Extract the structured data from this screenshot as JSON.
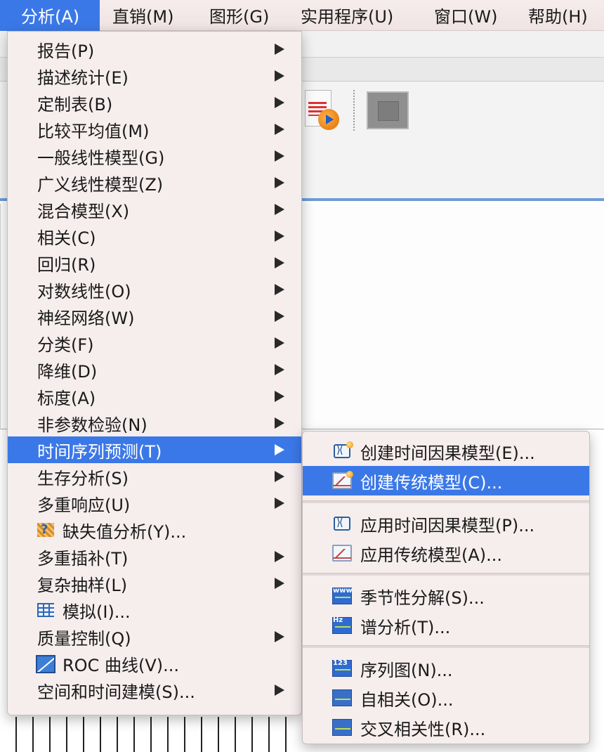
{
  "menubar": {
    "items": [
      {
        "label": "分析(A)",
        "active": true
      },
      {
        "label": "直销(M)"
      },
      {
        "label": "图形(G)"
      },
      {
        "label": "实用程序(U)"
      },
      {
        "label": "窗口(W)"
      },
      {
        "label": "帮助(H)"
      }
    ]
  },
  "analyze_menu": {
    "items": [
      {
        "label": "报告(P)",
        "has_submenu": true
      },
      {
        "label": "描述统计(E)",
        "has_submenu": true
      },
      {
        "label": "定制表(B)",
        "has_submenu": true
      },
      {
        "label": "比较平均值(M)",
        "has_submenu": true
      },
      {
        "label": "一般线性模型(G)",
        "has_submenu": true
      },
      {
        "label": "广义线性模型(Z)",
        "has_submenu": true
      },
      {
        "label": "混合模型(X)",
        "has_submenu": true
      },
      {
        "label": "相关(C)",
        "has_submenu": true
      },
      {
        "label": "回归(R)",
        "has_submenu": true
      },
      {
        "label": "对数线性(O)",
        "has_submenu": true
      },
      {
        "label": "神经网络(W)",
        "has_submenu": true
      },
      {
        "label": "分类(F)",
        "has_submenu": true
      },
      {
        "label": "降维(D)",
        "has_submenu": true
      },
      {
        "label": "标度(A)",
        "has_submenu": true
      },
      {
        "label": "非参数检验(N)",
        "has_submenu": true
      },
      {
        "label": "时间序列预测(T)",
        "has_submenu": true,
        "active": true
      },
      {
        "label": "生存分析(S)",
        "has_submenu": true
      },
      {
        "label": "多重响应(U)",
        "has_submenu": true
      },
      {
        "label": "缺失值分析(Y)...",
        "icon": "missing-value-icon"
      },
      {
        "label": "多重插补(T)",
        "has_submenu": true
      },
      {
        "label": "复杂抽样(L)",
        "has_submenu": true
      },
      {
        "label": "模拟(I)...",
        "icon": "simulation-icon"
      },
      {
        "label": "质量控制(Q)",
        "has_submenu": true
      },
      {
        "label": "ROC 曲线(V)...",
        "icon": "roc-curve-icon"
      },
      {
        "label": "空间和时间建模(S)...",
        "has_submenu": true
      }
    ]
  },
  "time_series_submenu": {
    "groups": [
      [
        {
          "label": "创建时间因果模型(E)...",
          "icon": "temporal-causal-create-icon"
        },
        {
          "label": "创建传统模型(C)...",
          "icon": "traditional-model-create-icon",
          "active": true
        }
      ],
      [
        {
          "label": "应用时间因果模型(P)...",
          "icon": "temporal-causal-apply-icon"
        },
        {
          "label": "应用传统模型(A)...",
          "icon": "traditional-model-apply-icon"
        }
      ],
      [
        {
          "label": "季节性分解(S)...",
          "icon": "seasonal-decomposition-icon"
        },
        {
          "label": "谱分析(T)...",
          "icon": "spectral-analysis-icon"
        }
      ],
      [
        {
          "label": "序列图(N)...",
          "icon": "sequence-chart-icon"
        },
        {
          "label": "自相关(O)...",
          "icon": "autocorrelation-icon"
        },
        {
          "label": "交叉相关性(R)...",
          "icon": "cross-correlation-icon"
        }
      ]
    ],
    "icon_texts": {
      "seasonal": "www",
      "spectral": "Hz",
      "sequence": "123"
    }
  },
  "colors": {
    "highlight": "#3b78e7",
    "menu_bg": "#f6eded",
    "menubar_bg": "#f7ecec"
  }
}
